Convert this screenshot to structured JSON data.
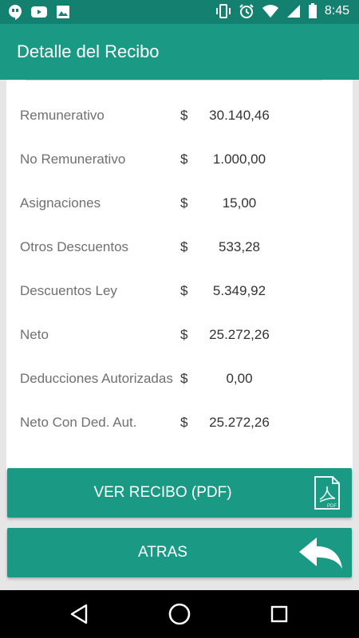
{
  "status_bar": {
    "time": "8:45",
    "icons_left": [
      "hangouts-icon",
      "youtube-icon",
      "image-icon"
    ],
    "icons_right": [
      "vibrate-icon",
      "alarm-icon",
      "wifi-icon",
      "signal-icon",
      "battery-icon"
    ]
  },
  "app_bar": {
    "title": "Detalle del Recibo"
  },
  "receipt": {
    "currency_symbol": "$",
    "rows": [
      {
        "label": "Remunerativo",
        "value": "30.140,46"
      },
      {
        "label": "No Remunerativo",
        "value": "1.000,00"
      },
      {
        "label": "Asignaciones",
        "value": "15,00"
      },
      {
        "label": "Otros Descuentos",
        "value": "533,28"
      },
      {
        "label": "Descuentos Ley",
        "value": "5.349,92"
      },
      {
        "label": "Neto",
        "value": "25.272,26"
      },
      {
        "label": "Deducciones Autorizadas",
        "value": "0,00"
      },
      {
        "label": "Neto Con Ded. Aut.",
        "value": "25.272,26"
      }
    ]
  },
  "buttons": {
    "view_pdf_label": "VER RECIBO (PDF)",
    "pdf_icon_text": "PDF",
    "back_label": "ATRAS"
  },
  "nav": {
    "items": [
      "back-icon",
      "home-icon",
      "recents-icon"
    ]
  },
  "colors": {
    "primary": "#1a9a85",
    "primary_dark": "#14806f",
    "background": "#e6e6e6"
  }
}
